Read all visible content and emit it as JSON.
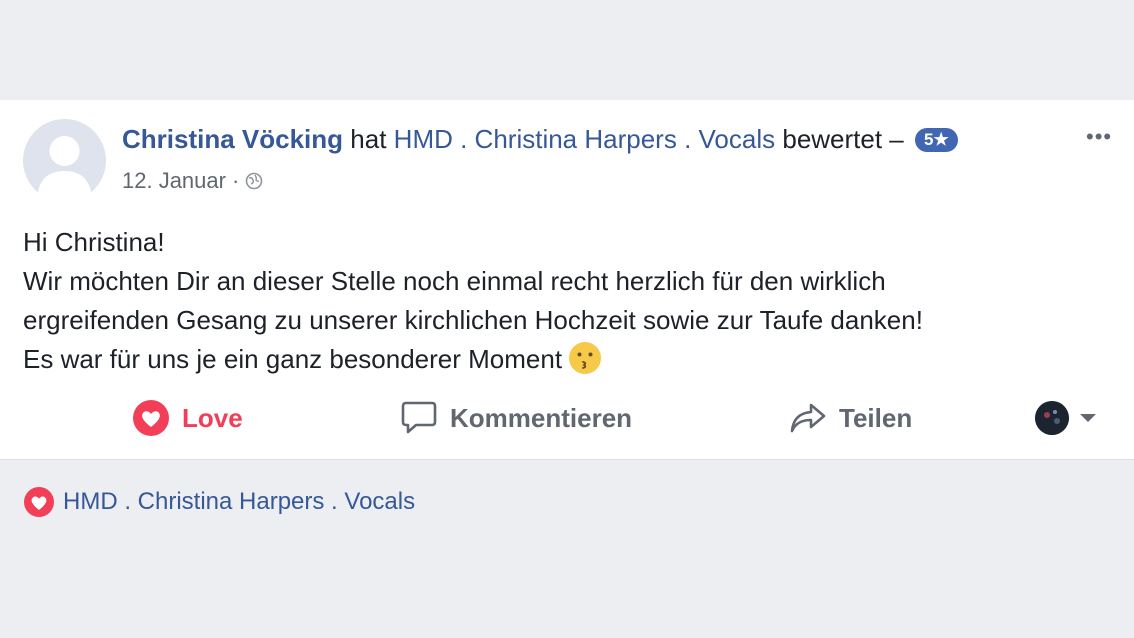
{
  "post": {
    "author": "Christina Vöcking",
    "verb": "hat",
    "page_name": "HMD . Christina Harpers . Vocals",
    "action": "bewertet –",
    "rating": "5★",
    "date": "12. Januar",
    "date_separator": "·",
    "privacy_icon": "globe-icon",
    "body_lines": [
      "Hi Christina!",
      "Wir möchten Dir an dieser Stelle noch einmal recht herzlich für den wirklich",
      "ergreifenden Gesang zu unserer kirchlichen Hochzeit sowie zur Taufe danken!",
      "Es war für uns je ein ganz besonderer Moment"
    ],
    "emoji": "kissing-face-icon"
  },
  "actions": {
    "love_label": "Love",
    "comment_label": "Kommentieren",
    "share_label": "Teilen"
  },
  "reactions": {
    "liked_by": "HMD . Christina Harpers . Vocals"
  },
  "colors": {
    "link": "#365899",
    "love": "#f33e58",
    "badge": "#4267b2",
    "background": "#eceef1"
  }
}
